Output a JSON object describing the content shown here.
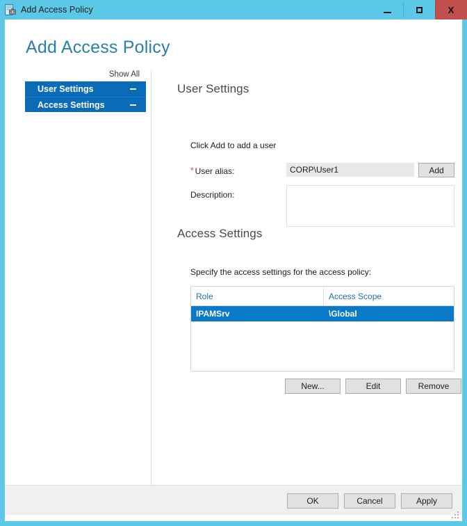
{
  "window": {
    "title": "Add Access Policy",
    "icon": "access-policy-icon",
    "controls": {
      "minimize": "minimize-icon",
      "maximize": "maximize-icon",
      "close": "close-icon",
      "close_glyph": "X"
    },
    "accent_color": "#5bc8e8",
    "close_color": "#c0504d"
  },
  "page": {
    "title": "Add Access Policy",
    "title_color": "#2a7fab"
  },
  "nav": {
    "show_all_label": "Show All",
    "items": [
      {
        "label": "User Settings",
        "collapse_icon": "minus-icon"
      },
      {
        "label": "Access Settings",
        "collapse_icon": "minus-icon"
      }
    ],
    "selected_color": "#0a6cb8"
  },
  "user_settings": {
    "heading": "User Settings",
    "hint": "Click Add to add a user",
    "alias_label": "User alias:",
    "alias_required_marker": "*",
    "alias_value": "CORP\\User1",
    "alias_placeholder": "",
    "add_button_label": "Add",
    "description_label": "Description:",
    "description_value": "",
    "description_placeholder": ""
  },
  "access_settings": {
    "heading": "Access Settings",
    "hint": "Specify the access settings for the access policy:",
    "table": {
      "columns": [
        "Role",
        "Access Scope"
      ],
      "rows": [
        {
          "role": "IPAMSrv",
          "scope": "\\Global",
          "selected": true
        }
      ],
      "selected_row_color": "#0a7ac8",
      "header_text_color": "#1f6fb0"
    },
    "buttons": [
      {
        "label": "New...",
        "name": "new-button"
      },
      {
        "label": "Edit",
        "name": "edit-button"
      },
      {
        "label": "Remove",
        "name": "remove-button"
      }
    ]
  },
  "footer": {
    "buttons": [
      {
        "label": "OK",
        "name": "ok-button"
      },
      {
        "label": "Cancel",
        "name": "cancel-button"
      },
      {
        "label": "Apply",
        "name": "apply-button"
      }
    ]
  }
}
